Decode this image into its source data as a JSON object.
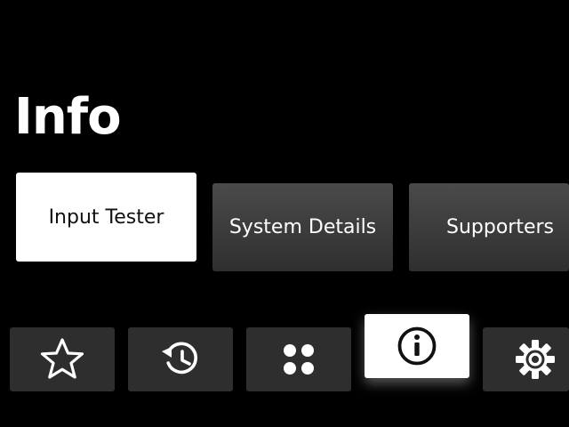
{
  "page": {
    "title": "Info"
  },
  "tiles": [
    {
      "label": "Input Tester",
      "focused": true
    },
    {
      "label": "System Details",
      "focused": false
    },
    {
      "label": "Supporters",
      "focused": false
    }
  ],
  "nav": [
    {
      "icon": "star-icon",
      "focused": false
    },
    {
      "icon": "history-icon",
      "focused": false
    },
    {
      "icon": "apps-grid-icon",
      "focused": false
    },
    {
      "icon": "info-icon",
      "focused": true
    },
    {
      "icon": "gear-icon",
      "focused": false
    }
  ],
  "colors": {
    "background": "#000000",
    "tile": "#3c3c3c",
    "nav_tile": "#2e2e2e",
    "focused": "#ffffff",
    "text_light": "#ffffff",
    "text_dark": "#111111"
  }
}
